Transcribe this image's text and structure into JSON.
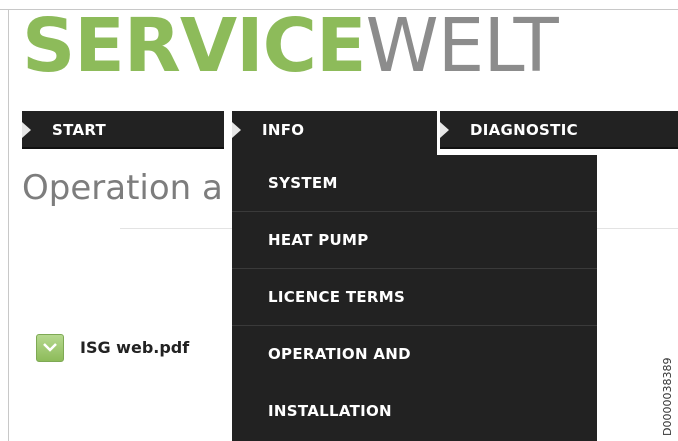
{
  "logo": {
    "part1": "SERVICE",
    "part2": "WELT"
  },
  "nav": {
    "tabs": [
      {
        "label": "START"
      },
      {
        "label": "INFO"
      },
      {
        "label": "DIAGNOSTIC"
      }
    ]
  },
  "page": {
    "title": "Operation a"
  },
  "file": {
    "name": "ISG web.pdf"
  },
  "dropdown": {
    "items": [
      {
        "label": "SYSTEM"
      },
      {
        "label": "HEAT PUMP"
      },
      {
        "label": "LICENCE TERMS"
      },
      {
        "label": "OPERATION AND",
        "label2": "INSTALLATION"
      }
    ]
  },
  "image_code": "D0000038389",
  "colors": {
    "brand_green": "#8dbb5a",
    "brand_grey": "#8c8c8c",
    "nav_bg": "#222222"
  }
}
